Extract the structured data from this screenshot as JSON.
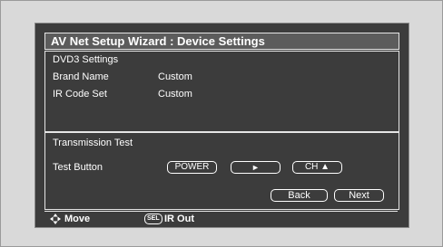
{
  "window": {
    "title": "AV Net Setup Wizard : Device Settings"
  },
  "settings": {
    "heading": "DVD3 Settings",
    "rows": [
      {
        "label": "Brand Name",
        "value": "Custom"
      },
      {
        "label": "IR Code Set",
        "value": "Custom"
      }
    ]
  },
  "test": {
    "heading": "Transmission Test",
    "button_row_label": "Test Button",
    "buttons": [
      {
        "label": "POWER"
      },
      {
        "label": "►"
      },
      {
        "label": "CH ▲"
      }
    ]
  },
  "nav": {
    "back_label": "Back",
    "next_label": "Next"
  },
  "help": {
    "move_icon": "diamond-arrows-icon",
    "move_label": "Move",
    "sel_badge": "SEL",
    "sel_label": "IR Out"
  }
}
